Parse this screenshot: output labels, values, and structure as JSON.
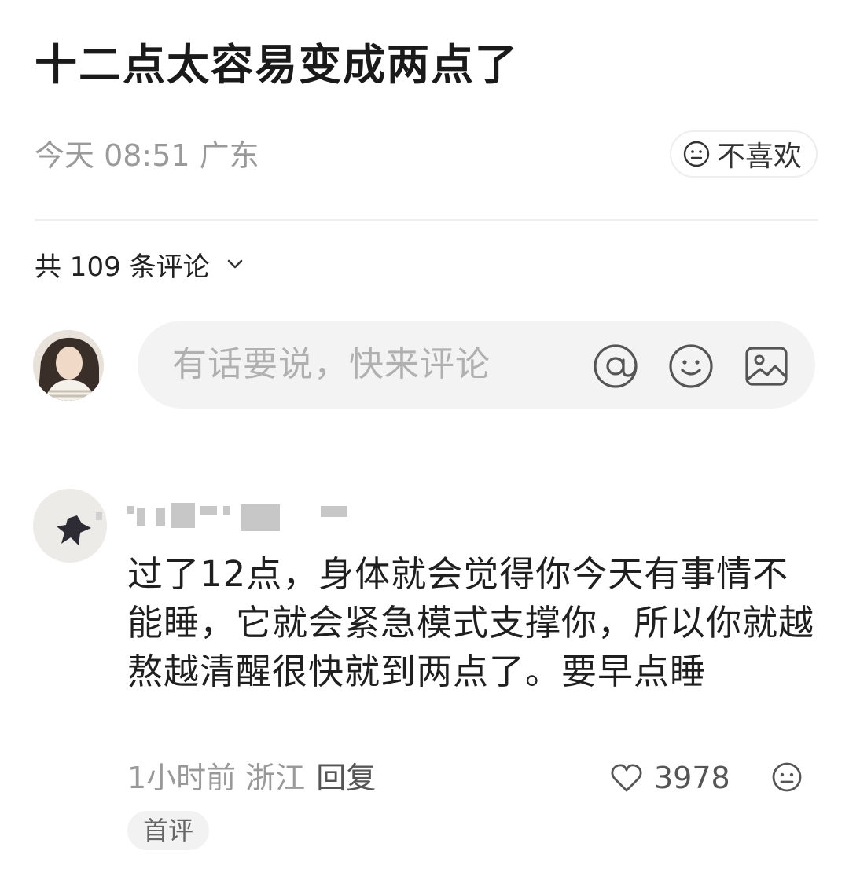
{
  "post": {
    "title": "十二点太容易变成两点了",
    "meta": "今天 08:51 广东",
    "dislike_label": "不喜欢"
  },
  "comments_header": {
    "count_label": "共 109 条评论"
  },
  "comment_input": {
    "placeholder": "有话要说，快来评论"
  },
  "comment": {
    "text": "过了12点，身体就会觉得你今天有事情不能睡，它就会紧急模式支撑你，所以你就越熬越清醒很快就到两点了。要早点睡",
    "time_location": "1小时前 浙江",
    "reply_label": "回复",
    "like_count": "3978",
    "badge": "首评"
  },
  "icons": {
    "dislike": "neutral-face-icon",
    "expand": "chevron-down-icon",
    "mention": "at-icon",
    "emoji": "smiley-icon",
    "image": "image-icon",
    "like": "heart-icon"
  },
  "colors": {
    "text_primary": "#1a1a1a",
    "text_secondary": "#9a9a9a",
    "input_bg": "#f3f3f3",
    "badge_bg": "#f2f2f2"
  }
}
